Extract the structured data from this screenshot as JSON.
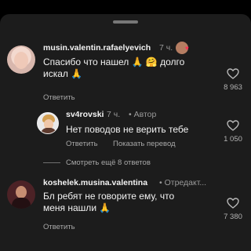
{
  "colors": {
    "background": "#1c1c1c",
    "text": "#f2f2f2",
    "secondary": "#a8a8a8",
    "like_red": "#ff2f55"
  },
  "comments": [
    {
      "username": "musin.valentin.rafaelyevich",
      "time": "7 ч.",
      "text": "Спасибо что нашел 🙏 🤗 долго искал 🙏",
      "reply_label": "Ответить",
      "likes": "8 963"
    },
    {
      "username": "sv4rovski",
      "time": "7 ч.",
      "author_badge": "• Автор",
      "text": "Нет поводов не верить тебе",
      "reply_label": "Ответить",
      "translate_label": "Показать перевод",
      "likes": "1 050"
    },
    {
      "username": "koshelek.musina.valentina",
      "time": "• Отредакт...",
      "text": "Бл ребят не говорите ему, что меня нашли 🙏",
      "reply_label": "Ответить",
      "likes": "7 380"
    }
  ],
  "view_more_replies": "Смотреть ещё 8 ответов",
  "icons": [
    "heart-icon",
    "liked-by-author-avatar-icon"
  ]
}
